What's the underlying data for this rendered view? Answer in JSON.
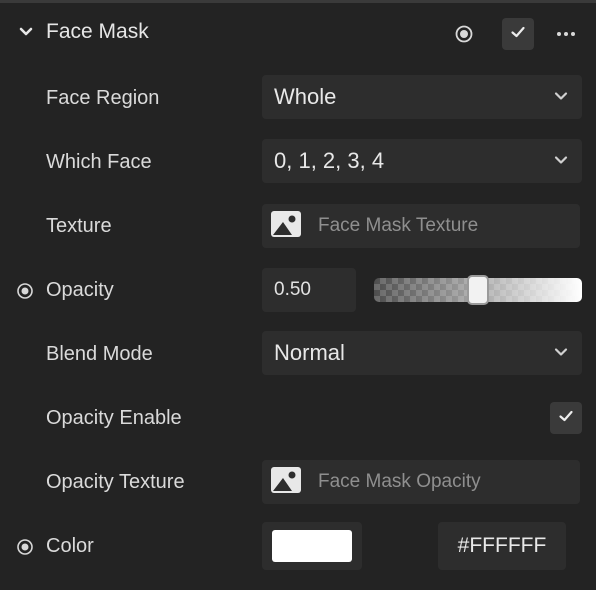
{
  "panel": {
    "title": "Face Mask",
    "header_icons": [
      "record-icon",
      "check-icon",
      "more-icon"
    ]
  },
  "rows": {
    "face_region": {
      "label": "Face Region",
      "value": "Whole"
    },
    "which_face": {
      "label": "Which Face",
      "value": "0, 1, 2, 3, 4"
    },
    "texture": {
      "label": "Texture",
      "asset": "Face Mask Texture"
    },
    "opacity": {
      "label": "Opacity",
      "value": "0.50",
      "slider_fraction": 0.5
    },
    "blend_mode": {
      "label": "Blend Mode",
      "value": "Normal"
    },
    "opacity_enable": {
      "label": "Opacity Enable",
      "checked": true
    },
    "opacity_texture": {
      "label": "Opacity Texture",
      "asset": "Face Mask Opacity"
    },
    "color": {
      "label": "Color",
      "hex": "#FFFFFF"
    }
  },
  "colors": {
    "background": "#232323",
    "field": "#2d2d2d",
    "swatch": "#FFFFFF"
  }
}
